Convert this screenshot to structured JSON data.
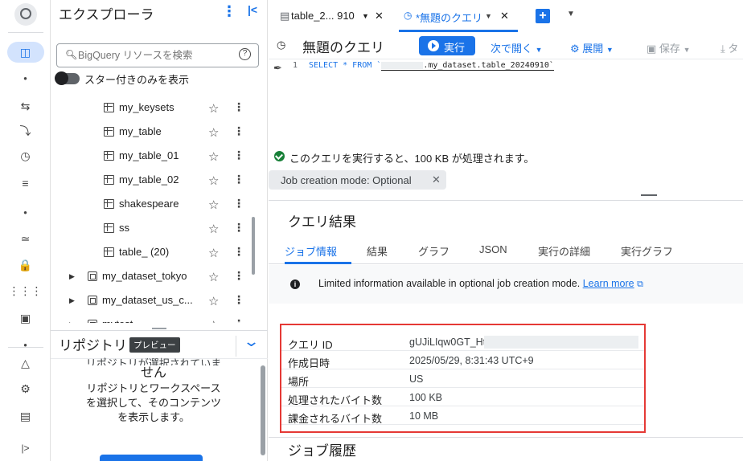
{
  "explorer": {
    "title": "エクスプローラ",
    "search_placeholder": "BigQuery リソースを検索",
    "starred_toggle_label": "スター付きのみを表示",
    "items": [
      {
        "label": "my_keysets",
        "type": "table",
        "indent": 1
      },
      {
        "label": "my_table",
        "type": "table",
        "indent": 1
      },
      {
        "label": "my_table_01",
        "type": "table",
        "indent": 1
      },
      {
        "label": "my_table_02",
        "type": "table",
        "indent": 1
      },
      {
        "label": "shakespeare",
        "type": "table",
        "indent": 1
      },
      {
        "label": "ss",
        "type": "table",
        "indent": 1
      },
      {
        "label": "table_ (20)",
        "type": "sharded",
        "indent": 1
      },
      {
        "label": "my_dataset_tokyo",
        "type": "dataset",
        "indent": 0
      },
      {
        "label": "my_dataset_us_c...",
        "type": "dataset",
        "indent": 0
      },
      {
        "label": "mytest",
        "type": "dataset",
        "indent": 0
      }
    ]
  },
  "repository": {
    "title": "リポジトリ",
    "badge": "プレビュー",
    "message_clipped": "リポジトリが選択されていま",
    "message_line2": "せん",
    "message_body": [
      "リポジトリとワークスペース",
      "を選択して、そのコンテンツ",
      "を表示します。"
    ]
  },
  "tabs": [
    {
      "label": "table_2... 910",
      "icon": "table-icon",
      "active": false
    },
    {
      "label": "*無題のクエリ",
      "icon": "query-icon",
      "active": true
    }
  ],
  "toolbar": {
    "title": "無題のクエリ",
    "run": "実行",
    "open_in": "次で開く",
    "expand": "展開",
    "save": "保存",
    "overflow": "タ"
  },
  "editor": {
    "line_number": "1",
    "code_prefix": "SELECT * FROM `",
    "code_suffix": ".my_dataset.table_20240910`"
  },
  "validator": {
    "message": "このクエリを実行すると、100 KB が処理されます。"
  },
  "chip": {
    "label": "Job creation mode: Optional"
  },
  "results": {
    "title": "クエリ結果",
    "tabs": [
      "ジョブ情報",
      "結果",
      "グラフ",
      "JSON",
      "実行の詳細",
      "実行グラフ"
    ],
    "active_tab": "ジョブ情報",
    "info_text": "Limited information available in optional job creation mode.",
    "info_link": "Learn more",
    "job_info": [
      {
        "key": "クエリ ID",
        "value": "gUJiLIqw0GT_HtbU"
      },
      {
        "key": "作成日時",
        "value": "2025/05/29, 8:31:43 UTC+9"
      },
      {
        "key": "場所",
        "value": "US"
      },
      {
        "key": "処理されたバイト数",
        "value": "100 KB"
      },
      {
        "key": "課金されるバイト数",
        "value": "10 MB"
      }
    ],
    "history_title": "ジョブ履歴"
  },
  "colors": {
    "accent": "#1a73e8",
    "highlight_box": "#e53935",
    "success": "#188038"
  }
}
